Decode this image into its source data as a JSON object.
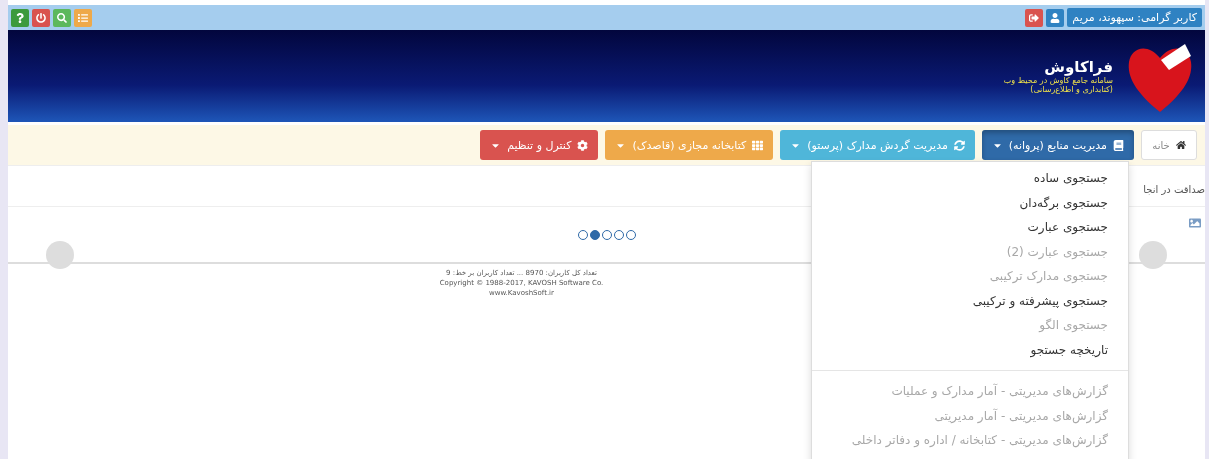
{
  "top_bar": {
    "user_label": "کاربر گرامی: سپهوند، مریم"
  },
  "header": {
    "title": "فراکاوش",
    "subtitle": "سامانه جامع کاوش در محیط وب",
    "subtitle_2": "(کتابداری و اطلاع‌رسانی)"
  },
  "nav": {
    "home": "خانه",
    "menus": [
      {
        "label": "مدیریت منابع (پروانه)",
        "color": "#2f6aa8",
        "expanded": true
      },
      {
        "label": "مدیریت گردش مدارک (پرستو)",
        "color": "#4fb6d9",
        "expanded": false
      },
      {
        "label": "کتابخانه مجازی (قاصدک)",
        "color": "#eea94a",
        "expanded": false
      },
      {
        "label": "کنترل و تنظیم",
        "color": "#d9534f",
        "expanded": false
      }
    ]
  },
  "dropdown": {
    "groups": [
      [
        {
          "label": "جستجوی ساده",
          "disabled": false
        },
        {
          "label": "جستجوی برگه‌دان",
          "disabled": false
        },
        {
          "label": "جستجوی عبارت",
          "disabled": false
        },
        {
          "label": "جستجوی عبارت (2)",
          "disabled": true
        },
        {
          "label": "جستجوی مدارک ترکیبی",
          "disabled": true
        },
        {
          "label": "جستجوی پیشرفته و ترکیبی",
          "disabled": false
        },
        {
          "label": "جستجوی الگو",
          "disabled": true
        },
        {
          "label": "تاریخچه جستجو",
          "disabled": false
        }
      ],
      [
        {
          "label": "گزارش‌های مدیریتی - آمار مدارک و عملیات",
          "disabled": true
        },
        {
          "label": "گزارش‌های مدیریتی - آمار مدیریتی",
          "disabled": true
        },
        {
          "label": "گزارش‌های مدیریتی - کتابخانه / اداره و دفاتر داخلی",
          "disabled": true
        }
      ]
    ]
  },
  "marquee": "صداقت در انجا",
  "carousel": {
    "dots": [
      {
        "selected": false
      },
      {
        "selected": true
      },
      {
        "selected": false
      },
      {
        "selected": false
      },
      {
        "selected": false
      }
    ]
  },
  "footer": [
    "تعداد کل کاربران: 8970 ... تعداد کاربران بر خط: 9",
    "Copyright © 1988-2017, KAVOSH Software Co.",
    "www.KavoshSoft.ir"
  ]
}
